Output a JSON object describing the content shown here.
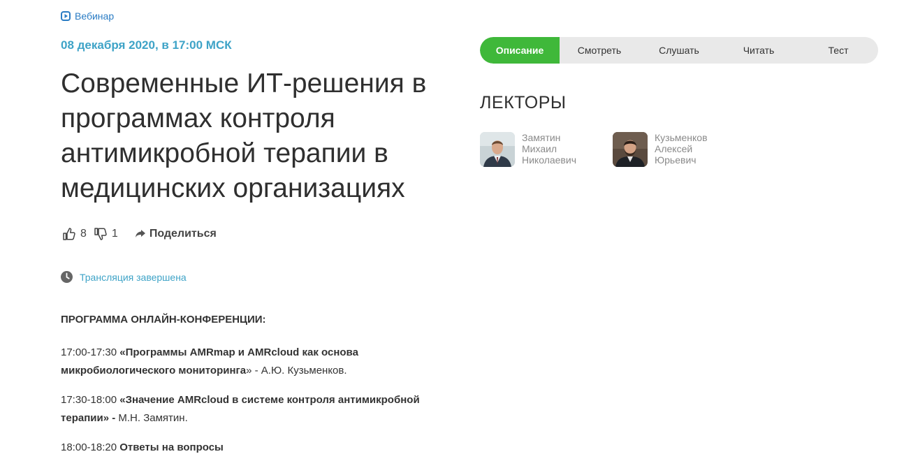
{
  "event": {
    "type_label": "Вебинар",
    "date": "08 декабря 2020, в 17:00 МСК",
    "title": "Современные ИТ-решения в программах контроля антимикробной терапии в медицинских организациях"
  },
  "reactions": {
    "likes": "8",
    "dislikes": "1",
    "share_label": "Поделиться"
  },
  "status": {
    "text": "Трансляция завершена"
  },
  "program": {
    "heading": "ПРОГРАММА ОНЛАЙН-КОНФЕРЕНЦИИ:",
    "items": [
      {
        "time": "17:00-17:30 ",
        "talk": "«Программы AMRmap и AMRcloud как основа микробиологического мониторинга",
        "speaker": "» - А.Ю. Кузьменков."
      },
      {
        "time": "17:30-18:00 ",
        "talk": "«Значение AMRcloud в системе контроля антимикробной терапии» -",
        "speaker": " М.Н. Замятин."
      },
      {
        "time": "18:00-18:20 ",
        "talk": "Ответы на вопросы",
        "speaker": ""
      }
    ]
  },
  "tabs": [
    "Описание",
    "Смотреть",
    "Слушать",
    "Читать",
    "Тест"
  ],
  "lecturers": {
    "title": "ЛЕКТОРЫ",
    "people": [
      {
        "last": "Замятин",
        "first": "Михаил",
        "middle": "Николаевич"
      },
      {
        "last": "Кузьменков",
        "first": "Алексей",
        "middle": "Юрьевич"
      }
    ]
  },
  "colors": {
    "accent_green": "#3fb83a",
    "link_blue": "#2a7cc4",
    "date_teal": "#3ea3c7",
    "tabs_bg": "#e9e9e9"
  },
  "icons": [
    "play-icon",
    "thumb-up-icon",
    "thumb-down-icon",
    "share-arrow-icon",
    "clock-icon"
  ]
}
